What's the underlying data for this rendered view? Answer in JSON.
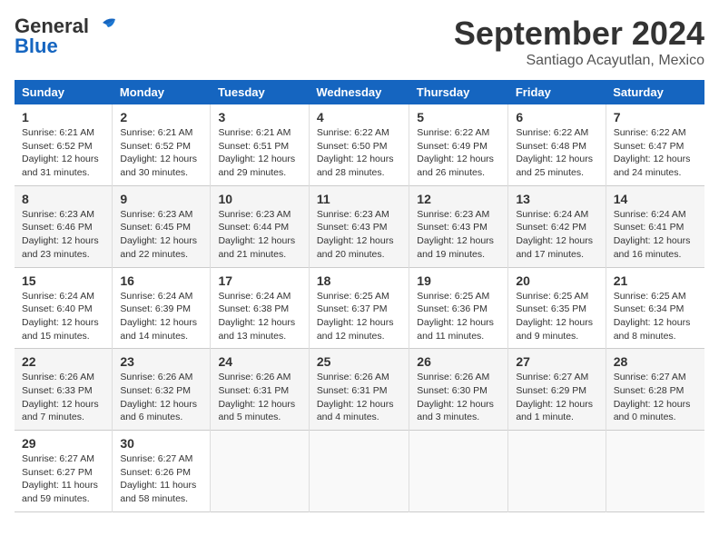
{
  "header": {
    "logo_line1": "General",
    "logo_line2": "Blue",
    "month": "September 2024",
    "location": "Santiago Acayutlan, Mexico"
  },
  "calendar": {
    "days_of_week": [
      "Sunday",
      "Monday",
      "Tuesday",
      "Wednesday",
      "Thursday",
      "Friday",
      "Saturday"
    ],
    "weeks": [
      [
        {
          "day": "1",
          "info": "Sunrise: 6:21 AM\nSunset: 6:52 PM\nDaylight: 12 hours and 31 minutes."
        },
        {
          "day": "2",
          "info": "Sunrise: 6:21 AM\nSunset: 6:52 PM\nDaylight: 12 hours and 30 minutes."
        },
        {
          "day": "3",
          "info": "Sunrise: 6:21 AM\nSunset: 6:51 PM\nDaylight: 12 hours and 29 minutes."
        },
        {
          "day": "4",
          "info": "Sunrise: 6:22 AM\nSunset: 6:50 PM\nDaylight: 12 hours and 28 minutes."
        },
        {
          "day": "5",
          "info": "Sunrise: 6:22 AM\nSunset: 6:49 PM\nDaylight: 12 hours and 26 minutes."
        },
        {
          "day": "6",
          "info": "Sunrise: 6:22 AM\nSunset: 6:48 PM\nDaylight: 12 hours and 25 minutes."
        },
        {
          "day": "7",
          "info": "Sunrise: 6:22 AM\nSunset: 6:47 PM\nDaylight: 12 hours and 24 minutes."
        }
      ],
      [
        {
          "day": "8",
          "info": "Sunrise: 6:23 AM\nSunset: 6:46 PM\nDaylight: 12 hours and 23 minutes."
        },
        {
          "day": "9",
          "info": "Sunrise: 6:23 AM\nSunset: 6:45 PM\nDaylight: 12 hours and 22 minutes."
        },
        {
          "day": "10",
          "info": "Sunrise: 6:23 AM\nSunset: 6:44 PM\nDaylight: 12 hours and 21 minutes."
        },
        {
          "day": "11",
          "info": "Sunrise: 6:23 AM\nSunset: 6:43 PM\nDaylight: 12 hours and 20 minutes."
        },
        {
          "day": "12",
          "info": "Sunrise: 6:23 AM\nSunset: 6:43 PM\nDaylight: 12 hours and 19 minutes."
        },
        {
          "day": "13",
          "info": "Sunrise: 6:24 AM\nSunset: 6:42 PM\nDaylight: 12 hours and 17 minutes."
        },
        {
          "day": "14",
          "info": "Sunrise: 6:24 AM\nSunset: 6:41 PM\nDaylight: 12 hours and 16 minutes."
        }
      ],
      [
        {
          "day": "15",
          "info": "Sunrise: 6:24 AM\nSunset: 6:40 PM\nDaylight: 12 hours and 15 minutes."
        },
        {
          "day": "16",
          "info": "Sunrise: 6:24 AM\nSunset: 6:39 PM\nDaylight: 12 hours and 14 minutes."
        },
        {
          "day": "17",
          "info": "Sunrise: 6:24 AM\nSunset: 6:38 PM\nDaylight: 12 hours and 13 minutes."
        },
        {
          "day": "18",
          "info": "Sunrise: 6:25 AM\nSunset: 6:37 PM\nDaylight: 12 hours and 12 minutes."
        },
        {
          "day": "19",
          "info": "Sunrise: 6:25 AM\nSunset: 6:36 PM\nDaylight: 12 hours and 11 minutes."
        },
        {
          "day": "20",
          "info": "Sunrise: 6:25 AM\nSunset: 6:35 PM\nDaylight: 12 hours and 9 minutes."
        },
        {
          "day": "21",
          "info": "Sunrise: 6:25 AM\nSunset: 6:34 PM\nDaylight: 12 hours and 8 minutes."
        }
      ],
      [
        {
          "day": "22",
          "info": "Sunrise: 6:26 AM\nSunset: 6:33 PM\nDaylight: 12 hours and 7 minutes."
        },
        {
          "day": "23",
          "info": "Sunrise: 6:26 AM\nSunset: 6:32 PM\nDaylight: 12 hours and 6 minutes."
        },
        {
          "day": "24",
          "info": "Sunrise: 6:26 AM\nSunset: 6:31 PM\nDaylight: 12 hours and 5 minutes."
        },
        {
          "day": "25",
          "info": "Sunrise: 6:26 AM\nSunset: 6:31 PM\nDaylight: 12 hours and 4 minutes."
        },
        {
          "day": "26",
          "info": "Sunrise: 6:26 AM\nSunset: 6:30 PM\nDaylight: 12 hours and 3 minutes."
        },
        {
          "day": "27",
          "info": "Sunrise: 6:27 AM\nSunset: 6:29 PM\nDaylight: 12 hours and 1 minute."
        },
        {
          "day": "28",
          "info": "Sunrise: 6:27 AM\nSunset: 6:28 PM\nDaylight: 12 hours and 0 minutes."
        }
      ],
      [
        {
          "day": "29",
          "info": "Sunrise: 6:27 AM\nSunset: 6:27 PM\nDaylight: 11 hours and 59 minutes."
        },
        {
          "day": "30",
          "info": "Sunrise: 6:27 AM\nSunset: 6:26 PM\nDaylight: 11 hours and 58 minutes."
        },
        {
          "day": "",
          "info": ""
        },
        {
          "day": "",
          "info": ""
        },
        {
          "day": "",
          "info": ""
        },
        {
          "day": "",
          "info": ""
        },
        {
          "day": "",
          "info": ""
        }
      ]
    ]
  }
}
